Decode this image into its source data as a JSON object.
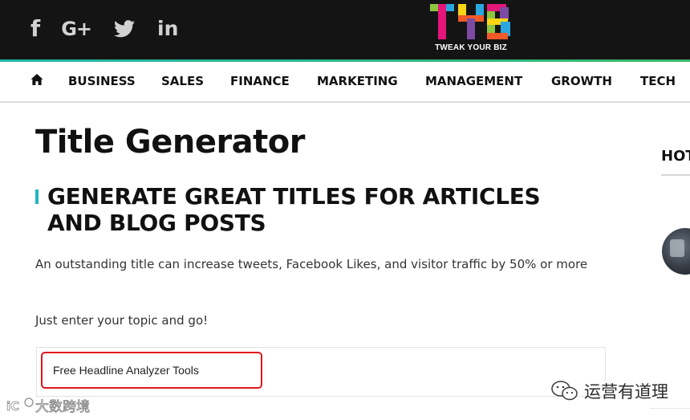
{
  "header": {
    "social": [
      {
        "name": "facebook-icon",
        "glyph": "f"
      },
      {
        "name": "google-plus-icon",
        "glyph": "G+"
      },
      {
        "name": "twitter-icon",
        "glyph": "twitter-bird"
      },
      {
        "name": "linkedin-icon",
        "glyph": "in"
      }
    ],
    "logo": {
      "text": "TWEAK YOUR BIZ",
      "letter_colors": [
        "#2aa7e0",
        "#e5157a",
        "#8ec63f",
        "#f7d416",
        "#f05a28",
        "#7c4aa3"
      ]
    },
    "accent_strip_colors": [
      "#1fb5a8",
      "#38b66a"
    ]
  },
  "nav": {
    "home_icon": "home-icon",
    "items": [
      "BUSINESS",
      "SALES",
      "FINANCE",
      "MARKETING",
      "MANAGEMENT",
      "GROWTH",
      "TECH"
    ]
  },
  "main": {
    "title": "Title Generator",
    "subheading": "GENERATE GREAT TITLES FOR ARTICLES AND BLOG POSTS",
    "description": "An outstanding title can increase tweets, Facebook Likes, and visitor traffic by 50% or more",
    "prompt": "Just enter your topic and go!",
    "topic_input_value": "Free Headline Analyzer Tools",
    "accent_color": "#1fb5c0",
    "highlight_color": "#e0151e"
  },
  "sidebar": {
    "title": "HOT"
  },
  "watermarks": {
    "left_text": "大数跨境",
    "right_text": "运营有道理"
  }
}
